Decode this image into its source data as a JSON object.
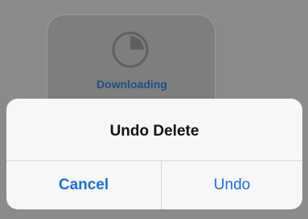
{
  "background_tile": {
    "label": "Downloading",
    "icon": "pie-progress-icon",
    "progress": 0.25
  },
  "alert": {
    "title": "Undo Delete",
    "cancel_label": "Cancel",
    "confirm_label": "Undo"
  },
  "colors": {
    "accent": "#1a6fe0",
    "dim_overlay": "#8b8b8b",
    "alert_background": "#f7f7f7",
    "tile_label": "#1f4f89"
  }
}
